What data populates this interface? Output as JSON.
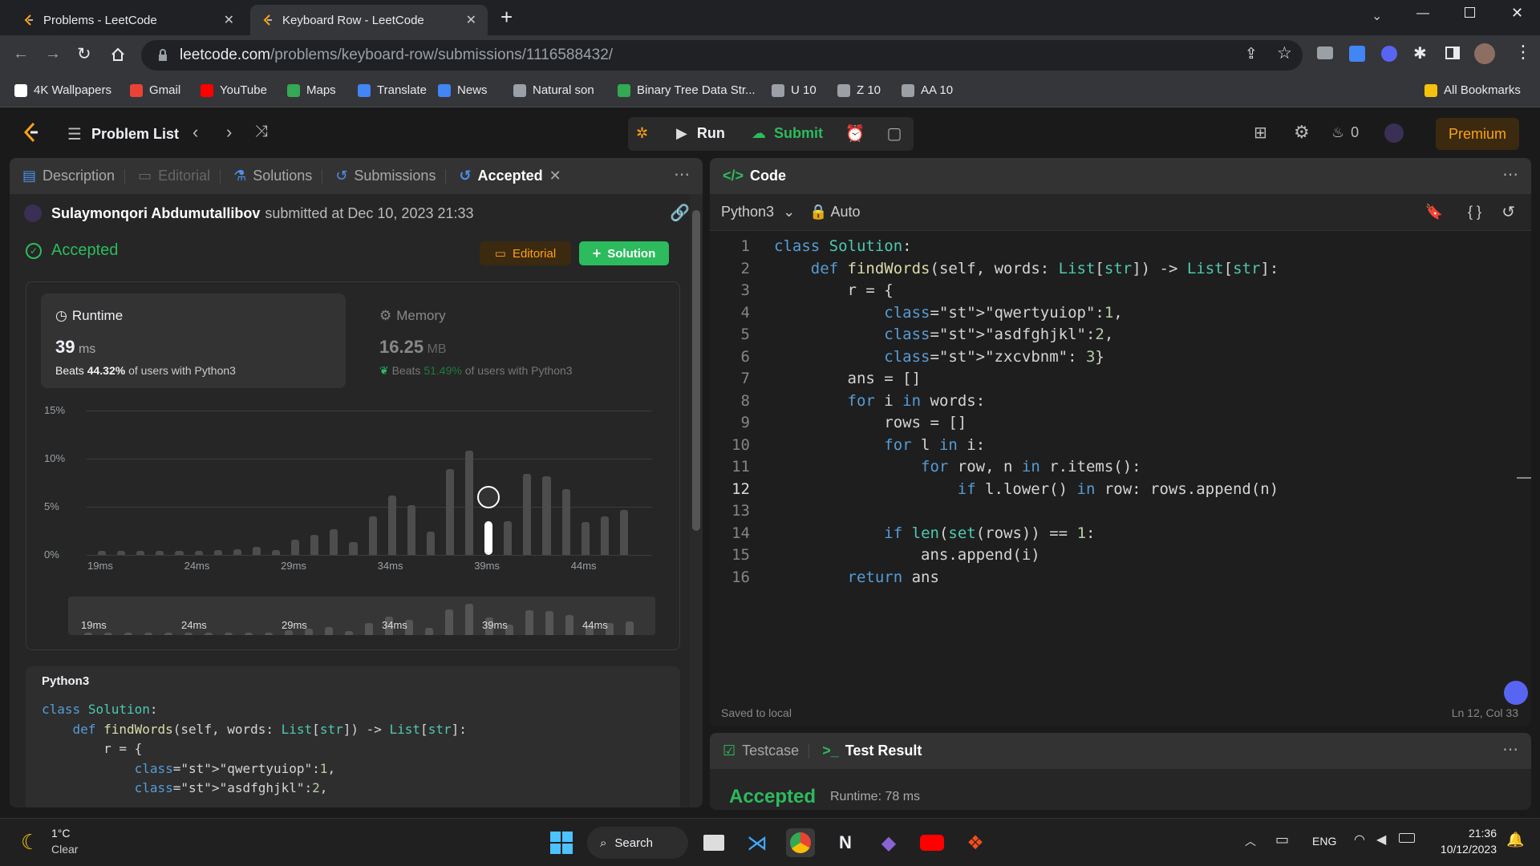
{
  "browser": {
    "tabs": [
      {
        "title": "Problems - LeetCode",
        "active": false
      },
      {
        "title": "Keyboard Row - LeetCode",
        "active": true
      }
    ],
    "new_tab": "+",
    "url_host": "leetcode.com",
    "url_path": "/problems/keyboard-row/submissions/1116588432/",
    "bookmarks": [
      {
        "label": "4K Wallpapers",
        "icon": "wallpaper-icon",
        "color": "#ffffff"
      },
      {
        "label": "Gmail",
        "icon": "gmail-icon",
        "color": "#ea4335"
      },
      {
        "label": "YouTube",
        "icon": "youtube-icon",
        "color": "#ff0000"
      },
      {
        "label": "Maps",
        "icon": "maps-icon",
        "color": "#34a853"
      },
      {
        "label": "Translate",
        "icon": "translate-icon",
        "color": "#4285f4"
      },
      {
        "label": "News",
        "icon": "news-icon",
        "color": "#4285f4"
      },
      {
        "label": "Natural son",
        "icon": "page-icon",
        "color": "#9aa0a6"
      },
      {
        "label": "Binary Tree Data Str...",
        "icon": "link-icon",
        "color": "#34a853"
      },
      {
        "label": "U 10",
        "icon": "page-icon",
        "color": "#9aa0a6"
      },
      {
        "label": "Z 10",
        "icon": "page-icon",
        "color": "#9aa0a6"
      },
      {
        "label": "AA 10",
        "icon": "page-icon",
        "color": "#9aa0a6"
      }
    ],
    "all_bookmarks": "All Bookmarks"
  },
  "nav": {
    "problem_list": "Problem List",
    "run": "Run",
    "submit": "Submit",
    "streak": "0",
    "premium": "Premium"
  },
  "left": {
    "tabs": [
      "Description",
      "Editorial",
      "Solutions",
      "Submissions",
      "Accepted"
    ],
    "user": "Sulaymonqori Abdumutallibov",
    "submitted_at": "submitted at Dec 10, 2023 21:33",
    "status": "Accepted",
    "editorial_btn": "Editorial",
    "solution_btn": "Solution",
    "runtime": {
      "label": "Runtime",
      "value": "39",
      "unit": "ms",
      "beats_prefix": "Beats",
      "beats": "44.32%",
      "beats_suffix": "of users with Python3"
    },
    "memory": {
      "label": "Memory",
      "value": "16.25",
      "unit": "MB",
      "beats_prefix": "Beats",
      "beats": "51.49%",
      "beats_suffix": "of users with Python3"
    },
    "code_lang": "Python3",
    "code_preview": [
      "class Solution:",
      "    def findWords(self, words: List[str]) -> List[str]:",
      "        r = {",
      "            \"qwertyuiop\":1,",
      "            \"asdfghjkl\":2,"
    ]
  },
  "chart_data": {
    "type": "bar",
    "ylabel": "",
    "y_ticks": [
      "15%",
      "10%",
      "5%",
      "0%"
    ],
    "ylim": [
      0,
      15
    ],
    "x_tick_labels": [
      "19ms",
      "24ms",
      "29ms",
      "34ms",
      "39ms",
      "44ms"
    ],
    "x": [
      19,
      20,
      21,
      22,
      23,
      24,
      25,
      26,
      27,
      28,
      29,
      30,
      31,
      32,
      33,
      34,
      35,
      36,
      37,
      38,
      39,
      40,
      41,
      42,
      43,
      44,
      45
    ],
    "values": [
      0.4,
      0.4,
      0.4,
      0.4,
      0.4,
      0.4,
      0.5,
      0.6,
      0.8,
      0.5,
      1.6,
      2.1,
      2.7,
      1.3,
      4.0,
      6.2,
      5.2,
      2.4,
      8.9,
      10.8,
      6.0,
      3.5,
      8.4,
      8.2,
      6.8,
      3.4,
      4.0,
      4.7
    ],
    "highlight_x": 39,
    "highlight_color": "#ffffff",
    "bar_color": "#4d4d4d"
  },
  "editor": {
    "title": "Code",
    "language": "Python3",
    "mode": "Auto",
    "status_left": "Saved to local",
    "status_right": "Ln 12, Col 33",
    "lines": [
      "class Solution:",
      "    def findWords(self, words: List[str]) -> List[str]:",
      "        r = {",
      "            \"qwertyuiop\":1,",
      "            \"asdfghjkl\":2,",
      "            \"zxcvbnm\": 3}",
      "        ans = []",
      "        for i in words:",
      "            rows = []",
      "            for l in i:",
      "                for row, n in r.items():",
      "                    if l.lower() in row: rows.append(n)",
      "",
      "            if len(set(rows)) == 1:",
      "                ans.append(i)",
      "        return ans"
    ]
  },
  "console": {
    "testcase": "Testcase",
    "test_result": "Test Result",
    "result": "Accepted",
    "runtime": "Runtime: 78 ms"
  },
  "taskbar": {
    "temp": "1°C",
    "weather": "Clear",
    "search": "Search",
    "lang": "ENG",
    "time": "21:36",
    "date": "10/12/2023"
  }
}
